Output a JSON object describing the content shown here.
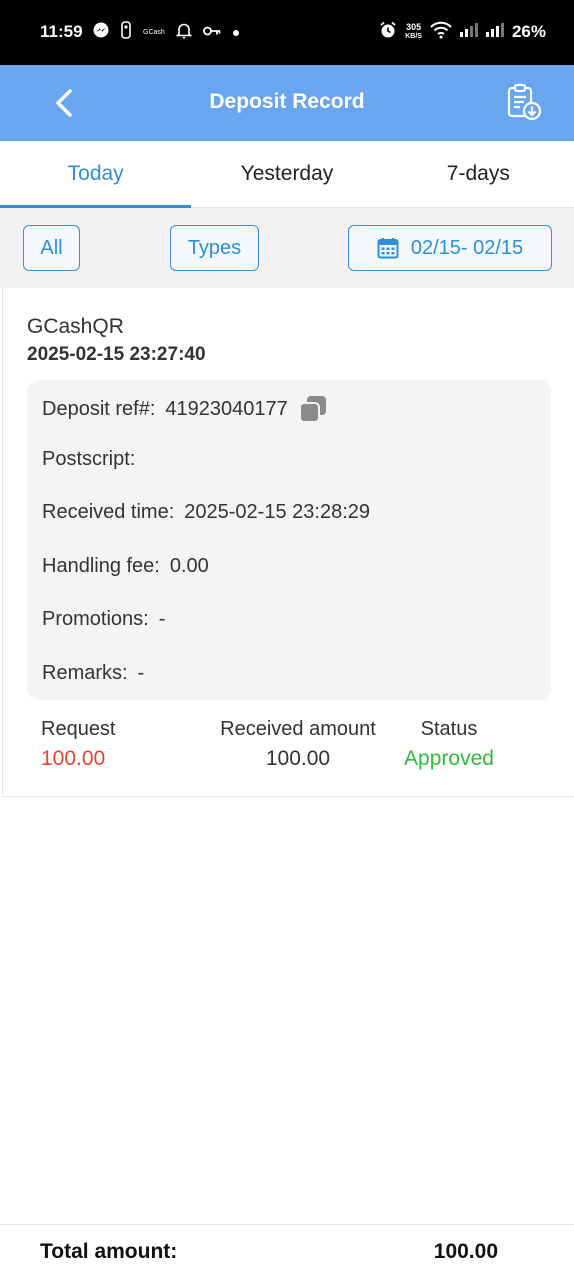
{
  "status_bar": {
    "time": "11:59",
    "left_icons": [
      "messenger-icon",
      "basketball-icon",
      "gcash-icon",
      "bell-icon",
      "key-icon",
      "dot-icon"
    ],
    "gcash_text": "GCash",
    "speed_value": "305",
    "speed_unit": "KB/S",
    "battery": "26%"
  },
  "header": {
    "title": "Deposit Record",
    "back_icon": "chevron-left-icon",
    "export_icon": "clipboard-download-icon",
    "color": "#6aa6f0"
  },
  "tabs": [
    {
      "label": "Today",
      "active": true
    },
    {
      "label": "Yesterday",
      "active": false
    },
    {
      "label": "7-days",
      "active": false
    }
  ],
  "filters": {
    "all_label": "All",
    "types_label": "Types",
    "date_range": "02/15- 02/15",
    "calendar_icon": "calendar-icon"
  },
  "record": {
    "type": "GCashQR",
    "datetime": "2025-02-15 23:27:40",
    "details": {
      "ref_label": "Deposit ref#:",
      "ref_value": "41923040177",
      "postscript_label": "Postscript:",
      "postscript_value": "",
      "received_time_label": "Received time:",
      "received_time_value": "2025-02-15 23:28:29",
      "fee_label": "Handling fee:",
      "fee_value": "0.00",
      "promotions_label": "Promotions:",
      "promotions_value": "-",
      "remarks_label": "Remarks:",
      "remarks_value": "-"
    },
    "request_label": "Request",
    "request_value": "100.00",
    "received_label": "Received amount",
    "received_value": "100.00",
    "status_label": "Status",
    "status_value": "Approved",
    "colors": {
      "request": "#e8412f",
      "status": "#2dbb3a",
      "accent": "#2e8fd8"
    }
  },
  "footer": {
    "total_label": "Total amount:",
    "total_value": "100.00"
  }
}
